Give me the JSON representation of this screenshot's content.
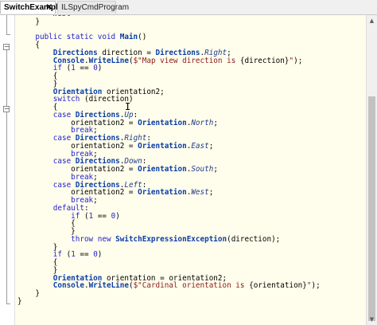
{
  "tabs": [
    {
      "label": "SwitchExample",
      "close": "✕",
      "active": true
    },
    {
      "label": "ILSpyCmdProgram",
      "active": false
    }
  ],
  "scrollbar": {
    "up": "▲",
    "down": "▼"
  },
  "fold": {
    "minus": "−"
  },
  "code_lines": [
    [
      {
        "t": "        "
      },
      {
        "t": "West",
        "c": "mb"
      }
    ],
    [
      {
        "t": "    }"
      }
    ],
    [
      {
        "t": ""
      }
    ],
    [
      {
        "t": "    "
      },
      {
        "t": "public static void",
        "c": "kw"
      },
      {
        "t": " "
      },
      {
        "t": "Main",
        "c": "mt"
      },
      {
        "t": "()"
      }
    ],
    [
      {
        "t": "    {"
      }
    ],
    [
      {
        "t": "        "
      },
      {
        "t": "Directions",
        "c": "ty"
      },
      {
        "t": " direction = "
      },
      {
        "t": "Directions",
        "c": "ty"
      },
      {
        "t": "."
      },
      {
        "t": "Right",
        "c": "mb"
      },
      {
        "t": ";"
      }
    ],
    [
      {
        "t": "        "
      },
      {
        "t": "Console",
        "c": "ty"
      },
      {
        "t": "."
      },
      {
        "t": "WriteLine",
        "c": "mt"
      },
      {
        "t": "("
      },
      {
        "t": "$\"Map view direction is ",
        "c": "str"
      },
      {
        "t": "{direction}"
      },
      {
        "t": "\"",
        "c": "str"
      },
      {
        "t": ");"
      }
    ],
    [
      {
        "t": "        "
      },
      {
        "t": "if",
        "c": "kw"
      },
      {
        "t": " ("
      },
      {
        "t": "1",
        "c": "kw"
      },
      {
        "t": " == "
      },
      {
        "t": "0",
        "c": "kw"
      },
      {
        "t": ")"
      }
    ],
    [
      {
        "t": "        {"
      }
    ],
    [
      {
        "t": "        }"
      }
    ],
    [
      {
        "t": "        "
      },
      {
        "t": "Orientation",
        "c": "ty"
      },
      {
        "t": " orientation2;"
      }
    ],
    [
      {
        "t": "        "
      },
      {
        "t": "switch",
        "c": "kw"
      },
      {
        "t": " (direction)"
      }
    ],
    [
      {
        "t": "        {"
      }
    ],
    [
      {
        "t": "        "
      },
      {
        "t": "case",
        "c": "kw"
      },
      {
        "t": " "
      },
      {
        "t": "Directions",
        "c": "ty"
      },
      {
        "t": "."
      },
      {
        "t": "Up",
        "c": "mb"
      },
      {
        "t": ":"
      }
    ],
    [
      {
        "t": "            orientation2 = "
      },
      {
        "t": "Orientation",
        "c": "ty"
      },
      {
        "t": "."
      },
      {
        "t": "North",
        "c": "mb"
      },
      {
        "t": ";"
      }
    ],
    [
      {
        "t": "            "
      },
      {
        "t": "break",
        "c": "kw"
      },
      {
        "t": ";"
      }
    ],
    [
      {
        "t": "        "
      },
      {
        "t": "case",
        "c": "kw"
      },
      {
        "t": " "
      },
      {
        "t": "Directions",
        "c": "ty"
      },
      {
        "t": "."
      },
      {
        "t": "Right",
        "c": "mb"
      },
      {
        "t": ":"
      }
    ],
    [
      {
        "t": "            orientation2 = "
      },
      {
        "t": "Orientation",
        "c": "ty"
      },
      {
        "t": "."
      },
      {
        "t": "East",
        "c": "mb"
      },
      {
        "t": ";"
      }
    ],
    [
      {
        "t": "            "
      },
      {
        "t": "break",
        "c": "kw"
      },
      {
        "t": ";"
      }
    ],
    [
      {
        "t": "        "
      },
      {
        "t": "case",
        "c": "kw"
      },
      {
        "t": " "
      },
      {
        "t": "Directions",
        "c": "ty"
      },
      {
        "t": "."
      },
      {
        "t": "Down",
        "c": "mb"
      },
      {
        "t": ":"
      }
    ],
    [
      {
        "t": "            orientation2 = "
      },
      {
        "t": "Orientation",
        "c": "ty"
      },
      {
        "t": "."
      },
      {
        "t": "South",
        "c": "mb"
      },
      {
        "t": ";"
      }
    ],
    [
      {
        "t": "            "
      },
      {
        "t": "break",
        "c": "kw"
      },
      {
        "t": ";"
      }
    ],
    [
      {
        "t": "        "
      },
      {
        "t": "case",
        "c": "kw"
      },
      {
        "t": " "
      },
      {
        "t": "Directions",
        "c": "ty"
      },
      {
        "t": "."
      },
      {
        "t": "Left",
        "c": "mb"
      },
      {
        "t": ":"
      }
    ],
    [
      {
        "t": "            orientation2 = "
      },
      {
        "t": "Orientation",
        "c": "ty"
      },
      {
        "t": "."
      },
      {
        "t": "West",
        "c": "mb"
      },
      {
        "t": ";"
      }
    ],
    [
      {
        "t": "            "
      },
      {
        "t": "break",
        "c": "kw"
      },
      {
        "t": ";"
      }
    ],
    [
      {
        "t": "        "
      },
      {
        "t": "default",
        "c": "kw"
      },
      {
        "t": ":"
      }
    ],
    [
      {
        "t": "            "
      },
      {
        "t": "if",
        "c": "kw"
      },
      {
        "t": " ("
      },
      {
        "t": "1",
        "c": "kw"
      },
      {
        "t": " == "
      },
      {
        "t": "0",
        "c": "kw"
      },
      {
        "t": ")"
      }
    ],
    [
      {
        "t": "            {"
      }
    ],
    [
      {
        "t": "            }"
      }
    ],
    [
      {
        "t": "            "
      },
      {
        "t": "throw new",
        "c": "kw"
      },
      {
        "t": " "
      },
      {
        "t": "SwitchExpressionException",
        "c": "ty"
      },
      {
        "t": "(direction);"
      }
    ],
    [
      {
        "t": "        }"
      }
    ],
    [
      {
        "t": "        "
      },
      {
        "t": "if",
        "c": "kw"
      },
      {
        "t": " ("
      },
      {
        "t": "1",
        "c": "kw"
      },
      {
        "t": " == "
      },
      {
        "t": "0",
        "c": "kw"
      },
      {
        "t": ")"
      }
    ],
    [
      {
        "t": "        {"
      }
    ],
    [
      {
        "t": "        }"
      }
    ],
    [
      {
        "t": "        "
      },
      {
        "t": "Orientation",
        "c": "ty"
      },
      {
        "t": " orientation = orientation2;"
      }
    ],
    [
      {
        "t": "        "
      },
      {
        "t": "Console",
        "c": "ty"
      },
      {
        "t": "."
      },
      {
        "t": "WriteLine",
        "c": "mt"
      },
      {
        "t": "("
      },
      {
        "t": "$\"Cardinal orientation is ",
        "c": "str"
      },
      {
        "t": "{orientation}"
      },
      {
        "t": "\"",
        "c": "str"
      },
      {
        "t": ");"
      }
    ],
    [
      {
        "t": "    }"
      }
    ],
    [
      {
        "t": "}"
      }
    ],
    [
      {
        "t": ""
      }
    ]
  ]
}
